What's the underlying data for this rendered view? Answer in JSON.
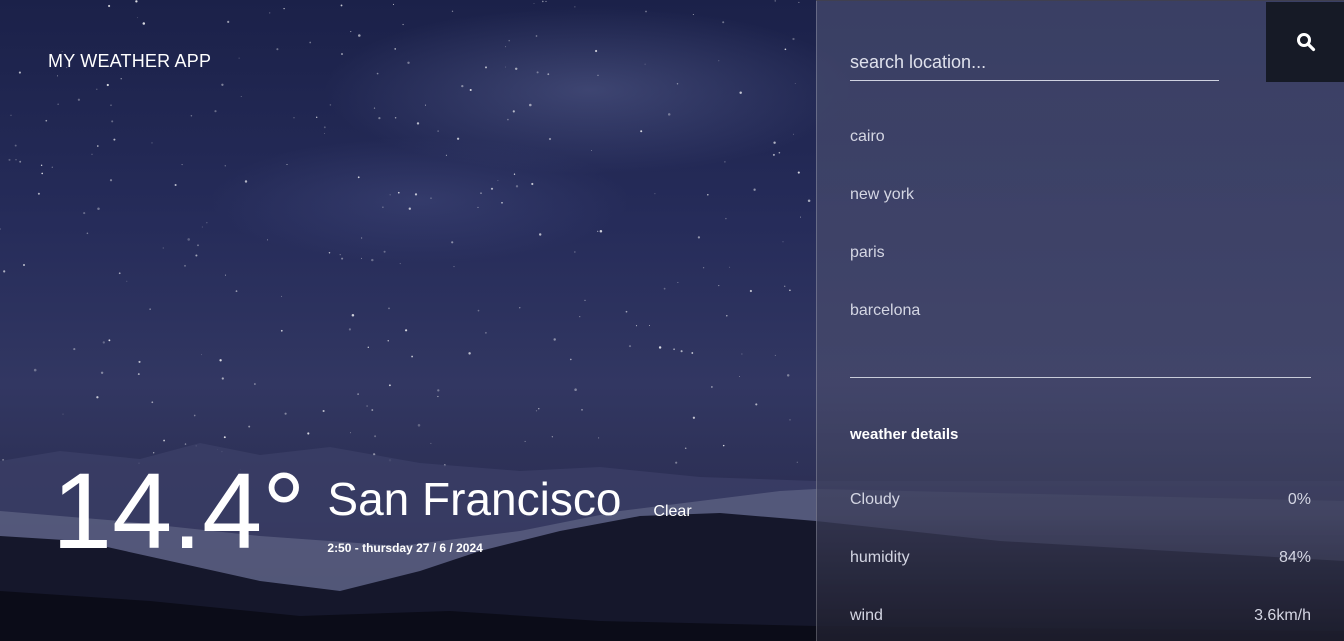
{
  "app": {
    "title": "MY WEATHER APP"
  },
  "current": {
    "temperature": "14.4°",
    "city": "San Francisco",
    "datetime": "2:50 - thursday 27 / 6 / 2024",
    "condition": "Clear"
  },
  "search": {
    "placeholder": "search location...",
    "value": "",
    "icon": "search-icon"
  },
  "locations": [
    "cairo",
    "new york",
    "paris",
    "barcelona"
  ],
  "details": {
    "title": "weather details",
    "rows": [
      {
        "label": "Cloudy",
        "value": "0%"
      },
      {
        "label": "humidity",
        "value": "84%"
      },
      {
        "label": "wind",
        "value": "3.6km/h"
      }
    ]
  },
  "colors": {
    "sky_top": "#1b2149",
    "panel": "#464b6e",
    "search_button": "#161a26",
    "text": "#ffffff",
    "muted_text": "#d4d6e3"
  }
}
